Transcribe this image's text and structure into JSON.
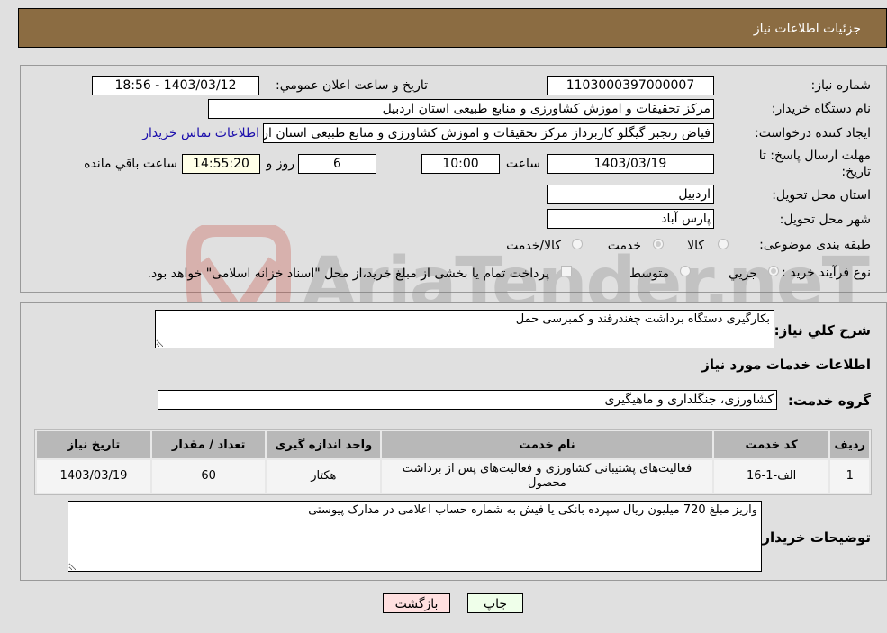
{
  "header": {
    "title": "جزئیات اطلاعات نیاز"
  },
  "form": {
    "need_number": {
      "label": "شماره نیاز:",
      "value": "1103000397000007"
    },
    "announce_datetime": {
      "label": "تاریخ و ساعت اعلان عمومي:",
      "value": "1403/03/12 - 18:56"
    },
    "buyer_org": {
      "label": "نام دستگاه خریدار:",
      "value": "مرکز تحقیقات و اموزش کشاورزی و منابع طبیعی استان اردبیل"
    },
    "requester": {
      "label": "ایجاد کننده درخواست:",
      "value": "فیاض رنجبر گیگلو کاربرداز مرکز تحقیقات و اموزش کشاورزی و منابع طبیعی استان اردبیل"
    },
    "contact_link": "اطلاعات تماس خریدار",
    "deadline": {
      "label": "مهلت ارسال پاسخ: تا تاریخ:",
      "date": "1403/03/19",
      "time_label": "ساعت",
      "time": "10:00",
      "days": "6",
      "days_label": "روز و",
      "remaining": "14:55:20",
      "remaining_label": "ساعت باقي مانده"
    },
    "delivery_province": {
      "label": "استان محل تحویل:",
      "value": "اردبیل"
    },
    "delivery_city": {
      "label": "شهر محل تحویل:",
      "value": "پارس آباد"
    },
    "category": {
      "label": "طبقه بندی موضوعی:",
      "options": [
        "کالا",
        "خدمت",
        "کالا/خدمت"
      ],
      "selected": "خدمت"
    },
    "purchase_type": {
      "label": "نوع فرآیند خرید :",
      "options": [
        "جزيي",
        "متوسط"
      ],
      "selected": "جزيي",
      "note": "پرداخت تمام یا بخشی از مبلغ خرید،از محل \"اسناد خزانه اسلامی\" خواهد بود."
    }
  },
  "details": {
    "description_label": "شرح کلي نیاز:",
    "description": "بکارگیری دستگاه برداشت چغندرقند و کمبرسی حمل",
    "services_heading": "اطلاعات خدمات مورد نیاز",
    "service_group_label": "گروه خدمت:",
    "service_group": "کشاورزی، جنگلداری و ماهیگیری",
    "table": {
      "headers": [
        "ردیف",
        "کد خدمت",
        "نام خدمت",
        "واحد اندازه گیری",
        "تعداد / مقدار",
        "تاریخ نیاز"
      ],
      "rows": [
        [
          "1",
          "الف-1-16",
          "فعالیت‌های پشتیبانی کشاورزی و فعالیت‌های پس از برداشت محصول",
          "هکتار",
          "60",
          "1403/03/19"
        ]
      ]
    },
    "buyer_notes_label": "توضیحات خریدار:",
    "buyer_notes": "واریز مبلغ 720 میلیون ریال سپرده بانکی یا فیش به شماره حساب اعلامی در مدارک پیوستی"
  },
  "buttons": {
    "print": "چاپ",
    "back": "بازگشت"
  },
  "watermark": {
    "text": "AriaTender.neT",
    "color": "#c0392b"
  }
}
